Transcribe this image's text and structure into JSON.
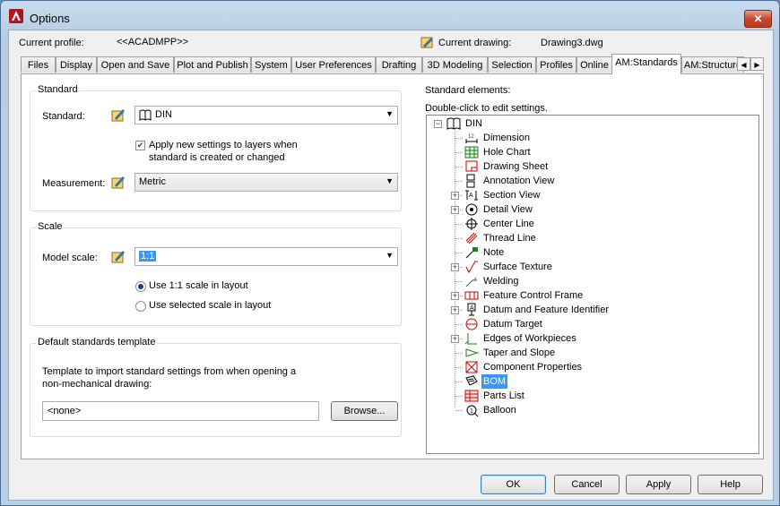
{
  "window": {
    "title": "Options",
    "close_glyph": "✕",
    "app_icon": "autocad-a-icon"
  },
  "profile": {
    "current_profile_label": "Current profile:",
    "current_profile_value": "<<ACADMPP>>",
    "current_drawing_label": "Current drawing:",
    "current_drawing_value": "Drawing3.dwg"
  },
  "tabs": [
    {
      "label": "Files"
    },
    {
      "label": "Display"
    },
    {
      "label": "Open and Save"
    },
    {
      "label": "Plot and Publish"
    },
    {
      "label": "System"
    },
    {
      "label": "User Preferences"
    },
    {
      "label": "Drafting"
    },
    {
      "label": "3D Modeling"
    },
    {
      "label": "Selection"
    },
    {
      "label": "Profiles"
    },
    {
      "label": "Online"
    },
    {
      "label": "AM:Standards",
      "active": true
    },
    {
      "label": "AM:Structure"
    }
  ],
  "tab_scroll": {
    "left": "◀",
    "right": "▶"
  },
  "standard_group": {
    "title": "Standard",
    "standard_label": "Standard:",
    "standard_value": "DIN",
    "apply_checkbox_line1": "Apply new settings to layers when",
    "apply_checkbox_line2": "standard is created or changed",
    "apply_checked": true,
    "check_glyph": "✔",
    "measurement_label": "Measurement:",
    "measurement_value": "Metric"
  },
  "scale_group": {
    "title": "Scale",
    "model_scale_label": "Model scale:",
    "model_scale_value": "1:1",
    "radio_1to1": "Use 1:1 scale in layout",
    "radio_selected": "Use selected scale in layout"
  },
  "template_group": {
    "title": "Default standards template",
    "desc_line1": "Template to import standard settings from when opening a",
    "desc_line2": "non-mechanical drawing:",
    "template_value": "<none>",
    "browse_label": "Browse..."
  },
  "elements": {
    "heading": "Standard elements:",
    "hint": "Double-click to edit settings.",
    "root": "DIN",
    "items": [
      {
        "label": "Dimension",
        "expandable": false
      },
      {
        "label": "Hole Chart",
        "expandable": false
      },
      {
        "label": "Drawing Sheet",
        "expandable": false
      },
      {
        "label": "Annotation View",
        "expandable": false
      },
      {
        "label": "Section View",
        "expandable": true
      },
      {
        "label": "Detail View",
        "expandable": true
      },
      {
        "label": "Center Line",
        "expandable": false
      },
      {
        "label": "Thread Line",
        "expandable": false
      },
      {
        "label": "Note",
        "expandable": false
      },
      {
        "label": "Surface Texture",
        "expandable": true
      },
      {
        "label": "Welding",
        "expandable": false
      },
      {
        "label": "Feature Control Frame",
        "expandable": true
      },
      {
        "label": "Datum and Feature Identifier",
        "expandable": true
      },
      {
        "label": "Datum Target",
        "expandable": false
      },
      {
        "label": "Edges of Workpieces",
        "expandable": true
      },
      {
        "label": "Taper and Slope",
        "expandable": false
      },
      {
        "label": "Component Properties",
        "expandable": false
      },
      {
        "label": "BOM",
        "expandable": false,
        "selected": true
      },
      {
        "label": "Parts List",
        "expandable": false
      },
      {
        "label": "Balloon",
        "expandable": false
      }
    ],
    "expander_glyph": "+",
    "collapse_glyph": "−"
  },
  "buttons": {
    "ok": "OK",
    "cancel": "Cancel",
    "apply": "Apply",
    "help": "Help"
  },
  "colors": {
    "selection": "#3399ff",
    "title_bar": "#b9cfe6",
    "close_button": "#c9482d"
  }
}
